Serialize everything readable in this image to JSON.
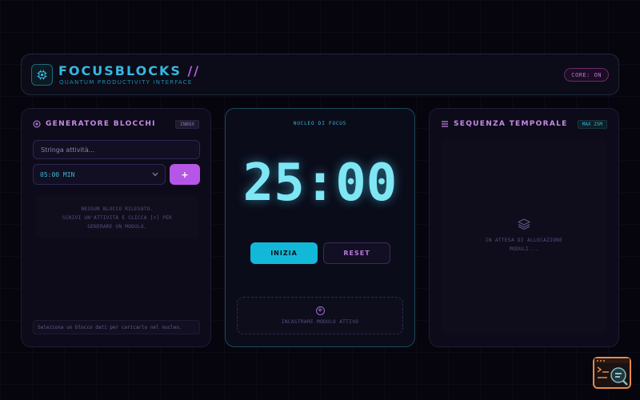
{
  "header": {
    "title": "FOCUSBLOCKS",
    "title_suffix": " //",
    "subtitle": "QUANTUM PRODUCTIVITY INTERFACE",
    "core_status": "CORE: ON",
    "logo_icon": "chip-icon"
  },
  "left_panel": {
    "title": "GENERATORE BLOCCHI",
    "tag": "INBOX",
    "task_placeholder": "Stringa attività...",
    "duration_value": "05:00 MIN",
    "add_label": "+",
    "empty_line1": "NESSUN BLOCCO RILEVATO.",
    "empty_line2": "SCRIVI UN'ATTIVITÀ E CLICCA [+] PER",
    "empty_line3": "GENERARE UN MODULO.",
    "footer_note": "Seleziona un blocco dati per caricarlo nel nucleo."
  },
  "center_panel": {
    "label": "NUCLEO DI FOCUS",
    "timer": "25:00",
    "start_label": "INIZIA",
    "reset_label": "RESET",
    "dropzone_label": "INCASTRARE MODULO ATTIVO"
  },
  "right_panel": {
    "title": "SEQUENZA TEMPORALE",
    "tag": "MAX 25M",
    "await_line1": "IN ATTESA DI ALLOCAZIONE",
    "await_line2": "MODULI..."
  },
  "colors": {
    "accent_cyan": "#12b8d8",
    "accent_purple": "#b656e6",
    "background": "#06050d"
  }
}
